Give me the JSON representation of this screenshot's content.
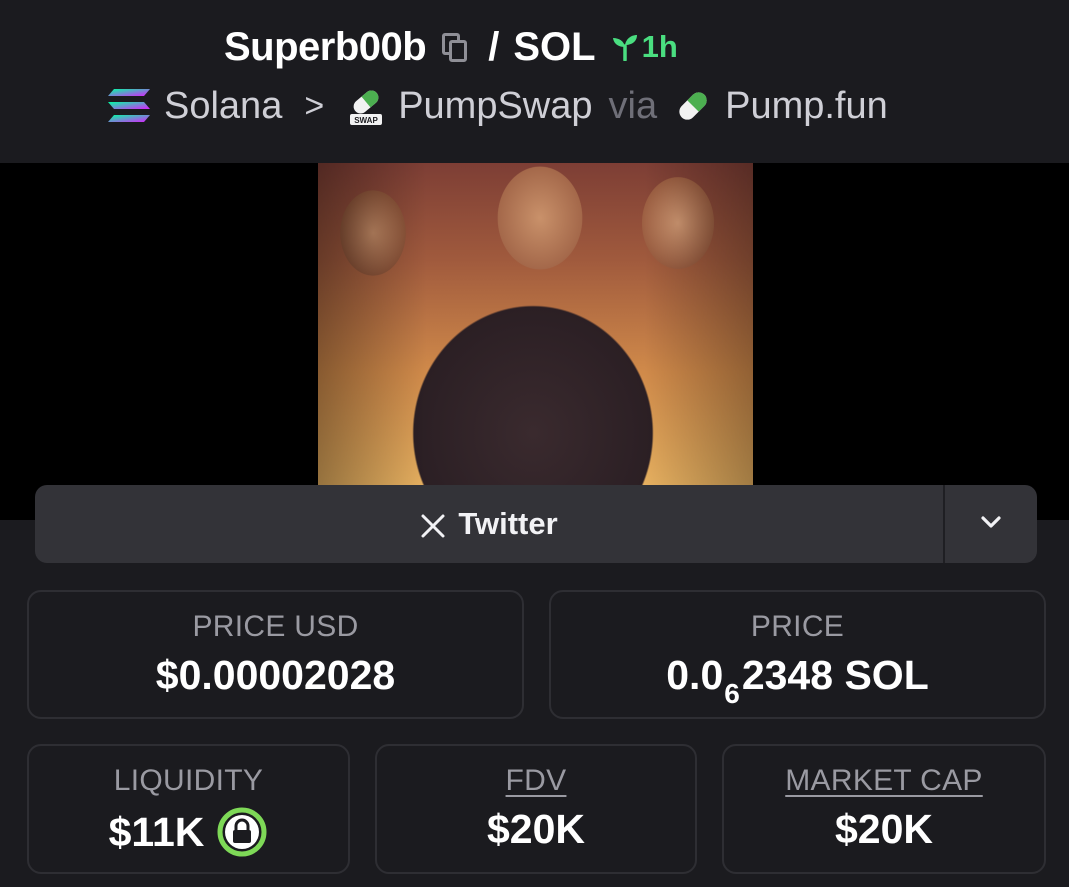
{
  "pair": {
    "base": "Superb00b",
    "slash": "/",
    "quote": "SOL",
    "age": "1h"
  },
  "breadcrumb": {
    "chain": "Solana",
    "separator": ">",
    "dex": "PumpSwap",
    "dex_badge": "SWAP",
    "via": "via",
    "launchpad": "Pump.fun"
  },
  "social": {
    "twitter_label": "Twitter"
  },
  "stats": {
    "price_usd": {
      "label": "PRICE USD",
      "value": "$0.00002028"
    },
    "price_native": {
      "label": "PRICE",
      "prefix": "0.0",
      "zeros": "6",
      "digits": "2348",
      "unit": "SOL"
    },
    "liquidity": {
      "label": "LIQUIDITY",
      "value": "$11K"
    },
    "fdv": {
      "label": "FDV",
      "value": "$20K"
    },
    "market_cap": {
      "label": "MARKET CAP",
      "value": "$20K"
    }
  },
  "icons": {
    "copy": "copy-icon",
    "age": "sprout-icon",
    "chain": "solana-icon",
    "dex": "pumpswap-icon",
    "launchpad": "pill-icon",
    "twitter": "x-icon",
    "more": "chevron-down-icon",
    "liquidity_locked": "lock-icon"
  },
  "colors": {
    "background": "#1b1b1f",
    "age_green": "#4ade80",
    "lock_green": "#7ed957",
    "button_bg": "#333338"
  }
}
